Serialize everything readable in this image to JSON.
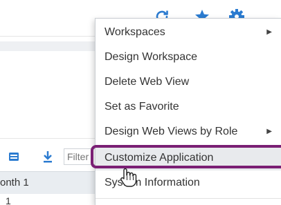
{
  "toolbar": {
    "icons": [
      "refresh-icon",
      "star-icon",
      "gear-icon"
    ],
    "accent": "#2b7bd0"
  },
  "grid_toolbar": {
    "filter_placeholder": "Filter"
  },
  "grid": {
    "header_partial": "onth 1",
    "row_partial": "1"
  },
  "menu": {
    "items": [
      {
        "label": "Workspaces",
        "has_submenu": true
      },
      {
        "label": "Design Workspace",
        "has_submenu": false
      },
      {
        "label": "Delete Web View",
        "has_submenu": false
      },
      {
        "label": "Set as Favorite",
        "has_submenu": false
      },
      {
        "label": "Design Web Views by Role",
        "has_submenu": true
      },
      {
        "label": "Customize Application",
        "has_submenu": false
      },
      {
        "label": "System Information",
        "has_submenu": false
      }
    ],
    "submenu_arrow": "▶",
    "highlight_color": "#7a1f74"
  }
}
